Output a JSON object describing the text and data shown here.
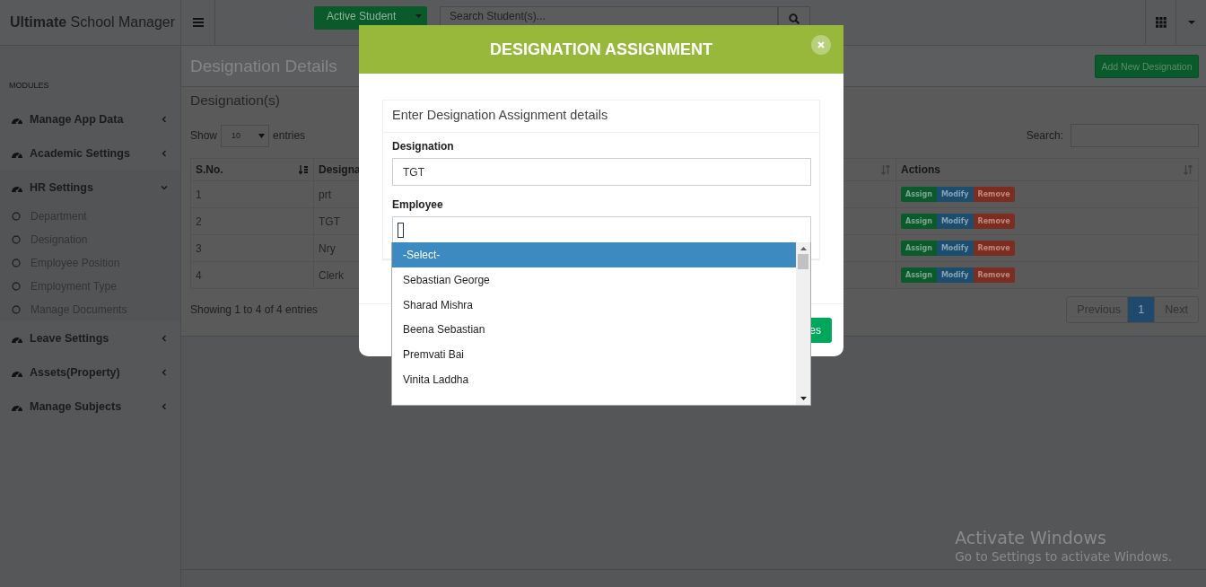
{
  "app": {
    "brand_bold": "Ultimate",
    "brand_rest": "School Manager"
  },
  "topbar": {
    "student_filter": "Active Student",
    "search": {
      "placeholder": "Search Student(s)..."
    }
  },
  "sidebar": {
    "heading": "MODULES",
    "items": [
      {
        "label": "Manage App Data",
        "expanded": false
      },
      {
        "label": "Academic Settings",
        "expanded": false
      },
      {
        "label": "HR Settings",
        "expanded": true,
        "children": [
          {
            "label": "Department"
          },
          {
            "label": "Designation"
          },
          {
            "label": "Employee Position"
          },
          {
            "label": "Employment Type"
          },
          {
            "label": "Manage Documents"
          }
        ]
      },
      {
        "label": "Leave Settings",
        "expanded": false
      },
      {
        "label": "Assets(Property)",
        "expanded": false
      },
      {
        "label": "Manage Subjects",
        "expanded": false
      }
    ]
  },
  "page": {
    "title": "Designation Details",
    "add_button": "Add New Designation"
  },
  "table_box": {
    "title": "Designation(s)",
    "length": {
      "show": "Show",
      "value": "10",
      "entries": "entries"
    },
    "search_label": "Search:",
    "columns": [
      {
        "label": "S.No.",
        "sorted": true
      },
      {
        "label": "Designa"
      },
      {
        "sorted": false
      },
      {
        "label": "Actions",
        "sorted": false
      }
    ],
    "rows": [
      {
        "cells": [
          "1",
          "prt"
        ],
        "actions": [
          {
            "label": "Assign",
            "kind": "assign"
          },
          {
            "label": "Modify",
            "kind": "modify"
          },
          {
            "label": "Remove",
            "kind": "remove"
          }
        ]
      },
      {
        "cells": [
          "2",
          "TGT"
        ],
        "actions": [
          {
            "label": "Assign",
            "kind": "assign"
          },
          {
            "label": "Modify",
            "kind": "modify"
          },
          {
            "label": "Remove",
            "kind": "remove"
          }
        ]
      },
      {
        "cells": [
          "3",
          "Nry"
        ],
        "actions": [
          {
            "label": "Assign",
            "kind": "assign"
          },
          {
            "label": "Modify",
            "kind": "modify"
          },
          {
            "label": "Remove",
            "kind": "remove"
          }
        ]
      },
      {
        "cells": [
          "4",
          "Clerk"
        ],
        "actions": [
          {
            "label": "Assign",
            "kind": "assign"
          },
          {
            "label": "Modify",
            "kind": "modify"
          },
          {
            "label": "Remove",
            "kind": "remove"
          }
        ]
      }
    ],
    "info": "Showing 1 to 4 of 4 entries",
    "pagination": [
      {
        "label": "Previous",
        "selected": false
      },
      {
        "label": "1",
        "selected": true
      },
      {
        "label": "Next",
        "selected": false
      }
    ]
  },
  "modal": {
    "title": "DESIGNATION ASSIGNMENT",
    "panel_title": "Enter Designation Assignment details",
    "fields": [
      {
        "label": "Designation",
        "kind": "text",
        "value": "TGT"
      },
      {
        "label": "Employee",
        "kind": "combo"
      }
    ],
    "dropdown": {
      "options": [
        {
          "label": "-Select-",
          "selected": true
        },
        {
          "label": "Sebastian George",
          "selected": false
        },
        {
          "label": "Sharad Mishra",
          "selected": false
        },
        {
          "label": "Beena Sebastian",
          "selected": false
        },
        {
          "label": "Premvati Bai",
          "selected": false
        },
        {
          "label": "Vinita Laddha",
          "selected": false
        }
      ]
    },
    "footer_button": "es"
  },
  "os_notice": {
    "title": "Activate Windows",
    "text": "Go to Settings to activate Windows."
  }
}
